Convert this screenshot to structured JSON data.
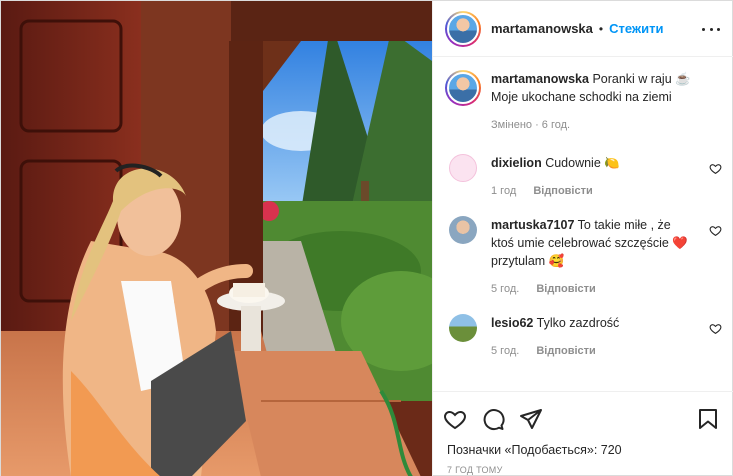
{
  "header": {
    "username": "martamanowska",
    "separator": "•",
    "follow_label": "Стежити",
    "more_icon": "more-options-icon"
  },
  "caption": {
    "username": "martamanowska",
    "text_line1": "Poranki w raju ☕",
    "text_line2": "Moje ukochane schodki na ziemi",
    "edited": "Змінено · 6 год."
  },
  "comments": [
    {
      "username": "dixielion",
      "text": "Cudownie 🍋",
      "time": "1 год",
      "reply": "Відповісти"
    },
    {
      "username": "martuska7107",
      "text": "To takie miłe , że ktoś umie celebrować szczęście ❤️ przytulam 🥰",
      "time": "5 год.",
      "reply": "Відповісти"
    },
    {
      "username": "lesio62",
      "text": "Tylko zazdrość",
      "time": "5 год.",
      "reply": "Відповісти"
    }
  ],
  "likes_text": "Позначки «Подобається»: 720",
  "timestamp": "7 ГОД ТОМУ",
  "colors": {
    "accent": "#0095f6",
    "text": "#262626",
    "muted": "#8e8e8e",
    "border": "#efefef"
  }
}
